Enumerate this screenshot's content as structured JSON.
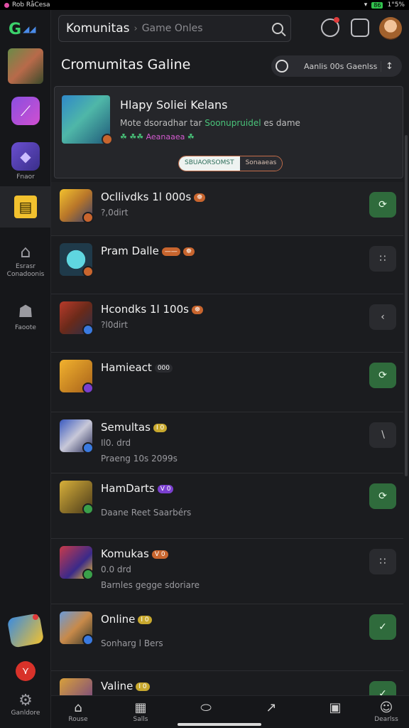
{
  "status": {
    "left_text": "Rob Ra̐Cesa",
    "battery": "86",
    "time": "1°5%"
  },
  "sidebar": {
    "items": [
      {
        "label": "",
        "icon": "hero-avatar-icon"
      },
      {
        "label": "",
        "icon": "trending-chart-icon"
      },
      {
        "label": "Fnaor",
        "icon": "cube-icon"
      },
      {
        "label": "",
        "icon": "store-icon"
      },
      {
        "label": "Esrasr Conadoonis",
        "icon": "house-icon"
      },
      {
        "label": "Faoote",
        "icon": "people-icon"
      }
    ],
    "bottom_label": "Ganldore"
  },
  "topbar": {
    "title": "Komunitas",
    "separator": "›",
    "placeholder": "Game Onles"
  },
  "header": {
    "title": "Cromumitas Galine",
    "filter_label": "Aanlis 00s Gaenlss",
    "filter_chevron": "↕"
  },
  "featured": {
    "title": "Hlapy Soliei Kelans",
    "subtitle_pre": "Mote dsoradhar tar ",
    "subtitle_hl": "Soonupruidel",
    "subtitle_post": " es dame",
    "line2": "☘ ☘☘ ",
    "line2_pink": "Aeanaaea",
    "line2_end": " ☘",
    "seg_a": "SBUAORSOMST",
    "seg_b": "Sonaaeas"
  },
  "rows": [
    {
      "name": "Ocllivdks 1l 000s",
      "tag": "☸",
      "tag_color": "#c8652e",
      "sub": "?,0dirt",
      "sub2": "",
      "action": "⟳",
      "green": true
    },
    {
      "name": "Pram Dalle",
      "tag": "——",
      "tag_color": "#c8652e",
      "tag2": "☸",
      "sub": "",
      "sub2": "",
      "action": "∷",
      "green": false
    },
    {
      "name": "Hcondks 1l 100s",
      "tag": "☸",
      "tag_color": "#c8652e",
      "sub": "?l0dirt",
      "sub2": "",
      "action": "‹",
      "green": false
    },
    {
      "name": "Hamieact",
      "tag": "000",
      "tag_color": "#2a2b2f",
      "sub": "",
      "sub2": "",
      "action": "⟳",
      "green": true
    },
    {
      "name": "Semultas",
      "tag": "I 0",
      "tag_color": "#c8a82e",
      "sub": "Il0. drd",
      "sub2": "Praeng 10s 2099s",
      "action": "∖",
      "green": false
    },
    {
      "name": "HamDarts",
      "tag": "V 0",
      "tag_color": "#7a3fcf",
      "sub": "",
      "sub2": "Daane Reet Saarbérs",
      "action": "⟳",
      "green": true
    },
    {
      "name": "Komukas",
      "tag": "V 0",
      "tag_color": "#c8652e",
      "sub": "0.0 drd",
      "sub2": "Barnles gegge sdoriare",
      "action": "∷",
      "green": false
    },
    {
      "name": "Online",
      "tag": "I 0",
      "tag_color": "#c8a82e",
      "sub": "",
      "sub2": "Sonharg l Bers",
      "action": "✓",
      "green": true
    },
    {
      "name": "Valine",
      "tag": "I 0",
      "tag_color": "#c8a82e",
      "sub": "",
      "sub2": "",
      "action": "✓",
      "green": true
    }
  ],
  "bottomnav": [
    {
      "label": "Rouse",
      "icon": "⌂"
    },
    {
      "label": "Salls",
      "icon": "▦"
    },
    {
      "label": "",
      "icon": "⬭"
    },
    {
      "label": "",
      "icon": "↗"
    },
    {
      "label": "",
      "icon": "▣"
    },
    {
      "label": "Dearlss",
      "icon": "☺"
    }
  ],
  "colors": {
    "accent_green": "#2f6b3c",
    "bg": "#1b1c1f",
    "sidebar_bg": "#16171a"
  }
}
